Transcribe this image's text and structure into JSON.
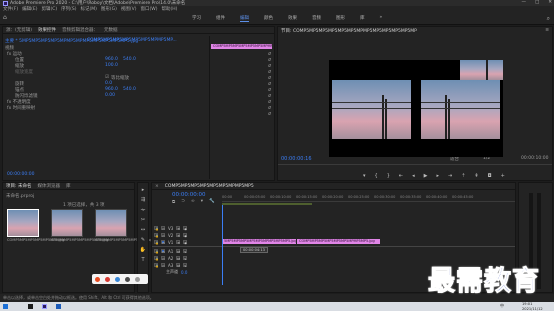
{
  "window": {
    "title": "Adobe Premiere Pro 2020 - C:\\用户\\Roboy\\文档\\Adobe\\Premiere Pro\\14.0\\未命名",
    "minimize": "—",
    "maximize": "□",
    "close": "✕"
  },
  "menu": [
    "文件(F)",
    "编辑(E)",
    "剪辑(C)",
    "序列(S)",
    "标记(M)",
    "图形(G)",
    "视图(V)",
    "窗口(W)",
    "帮助(H)"
  ],
  "workspaces": [
    "学习",
    "组件",
    "编辑",
    "颜色",
    "效果",
    "音频",
    "图形",
    "库",
    "»"
  ],
  "active_workspace": "编辑",
  "effect_controls": {
    "tabs": [
      "源：(无剪辑)",
      "效果控件",
      "音频剪辑混合器：",
      "元数据"
    ],
    "active_tab": "效果控件",
    "source_label": "主要 * 5MP5MP5MP5MP5MPMP5MPMP5MP5MP5MP5MP5.jpg",
    "sequence_label": "COMP5MP5MP5MP5MP5MP5MPMP5MP...",
    "clip_bar": "COMP5MP5MP5MP5MP5MP5MPMP5MP5.jpg",
    "video_header": "视频",
    "fx_motion": "fx 运动",
    "props": [
      {
        "name": "位置",
        "value": "960.0",
        "value2": "540.0"
      },
      {
        "name": "缩放",
        "value": "100.0",
        "value2": ""
      },
      {
        "name": "缩放宽度",
        "value": "",
        "value2": ""
      },
      {
        "name": "等比缩放",
        "value": "☑",
        "value2": ""
      },
      {
        "name": "旋转",
        "value": "0.0",
        "value2": ""
      },
      {
        "name": "锚点",
        "value": "960.0",
        "value2": "540.0"
      },
      {
        "name": "防闪烁滤镜",
        "value": "0.00",
        "value2": ""
      }
    ],
    "fx_opacity": "fx 不透明度",
    "fx_time_remap": "fx 时间重映射",
    "timecode": "00:00:00:00"
  },
  "program_monitor": {
    "title": "节目: COMP5MP5MP5MP5MP5MP5MPMP5MP5MP5MP5MP5MP",
    "timecode": "00:00:00:16",
    "fit": "适合",
    "quality": "1/2",
    "duration": "00:00:10:00"
  },
  "project": {
    "tabs": [
      "项目: 未命名",
      "媒体浏览器",
      "库"
    ],
    "active_tab": "项目: 未命名",
    "file": "未命名.prproj",
    "count": "1 项已选择，共 3 项",
    "items": [
      {
        "name": "COMP5MP5MP5MP5MP5MP5.jpg",
        "duration": "5:00"
      },
      {
        "name": "COMP5MP5MP5MP5MP5MP5.jpg",
        "duration": "5:00"
      },
      {
        "name": "COMP5MP5MP5MP5MP5MP5.jpg",
        "duration": "5:00"
      }
    ]
  },
  "timeline": {
    "tab": "COMP5MP5MP5MP5MP5MP5MPMP5MP5",
    "timecode": "00:00:00:00",
    "ruler": [
      "00:00",
      "00:00:05:00",
      "00:00:10:00",
      "00:00:15:00",
      "00:00:20:00",
      "00:00:25:00",
      "00:00:30:00",
      "00:00:35:00",
      "00:00:40:00",
      "00:00:45:00"
    ],
    "tracks": [
      {
        "name": "V3",
        "type": "video"
      },
      {
        "name": "V2",
        "type": "video"
      },
      {
        "name": "V1",
        "type": "video"
      },
      {
        "name": "A1",
        "type": "audio"
      },
      {
        "name": "A2",
        "type": "audio"
      },
      {
        "name": "A3",
        "type": "audio"
      },
      {
        "name": "主声道",
        "type": "master",
        "value": "0.0"
      }
    ],
    "clips": [
      {
        "label": "5MP5MP5MP5MP5MP5MPMP5MP5MP5.jpg"
      },
      {
        "label": "COMP5MP5MP5MP5MP5MP5MPMP5MP5.jpg"
      }
    ],
    "tooltip": "00:00:04:13"
  },
  "status": {
    "text": "单击以选择，或单击空白处并拖动以框选。使用 Shift、Alt 和 Ctrl 可获得其他选项。"
  },
  "taskbar": {
    "time": "19:01",
    "date": "2021/11/12",
    "lang": "中"
  },
  "watermark": "最需教育",
  "colors": {
    "accent": "#3b7ef5",
    "clip": "#e085e6",
    "watermark": "#1c39b5"
  }
}
